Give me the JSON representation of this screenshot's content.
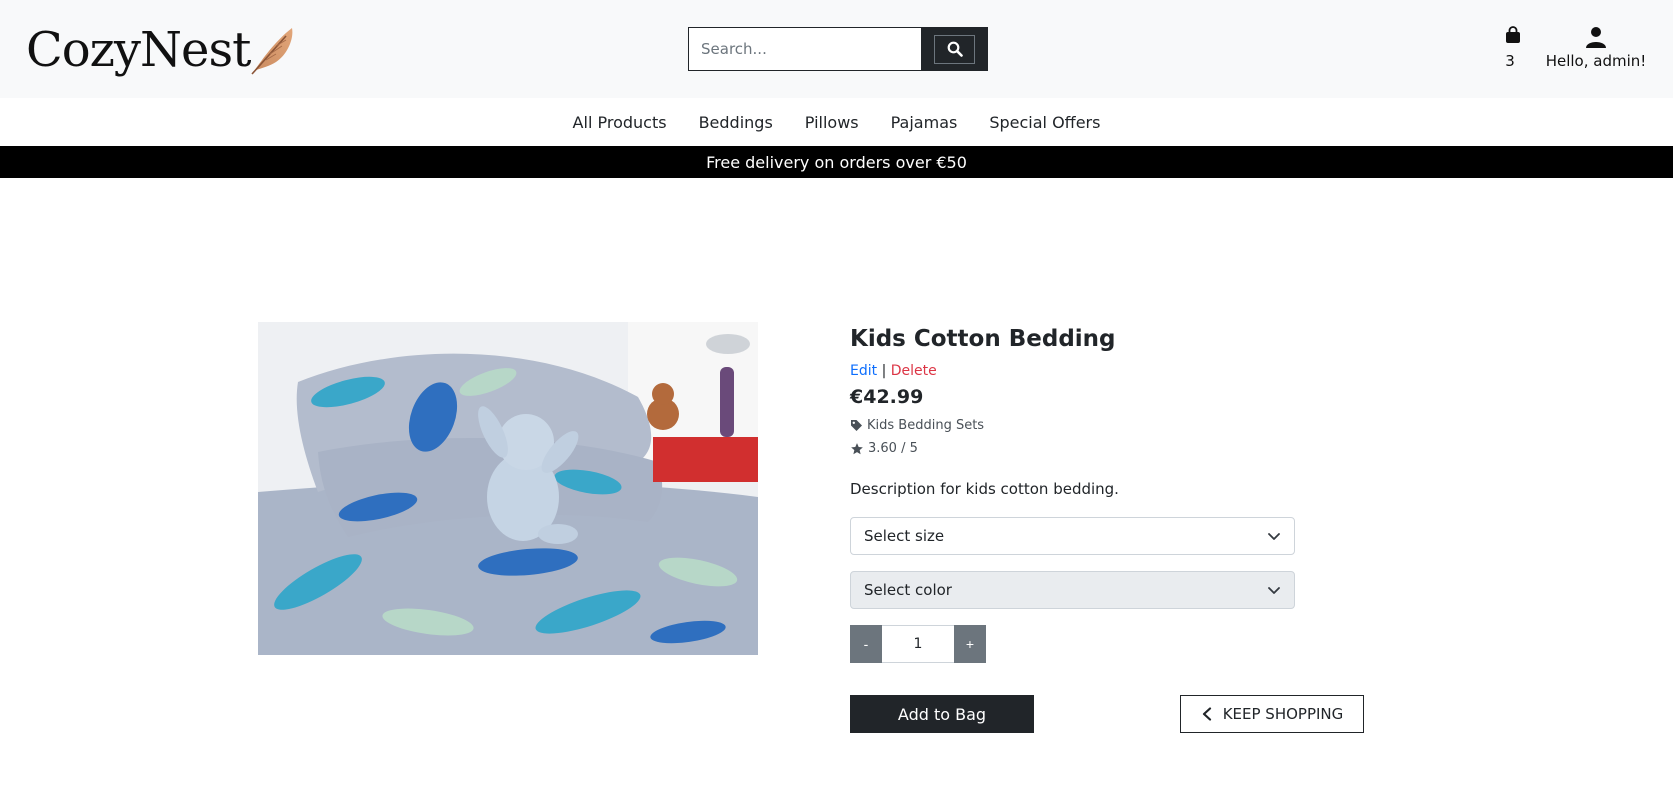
{
  "brand": {
    "name": "CozyNest",
    "logo_icon": "feather-icon"
  },
  "search": {
    "placeholder": "Search..."
  },
  "account": {
    "bag_count": "3",
    "greeting": "Hello, admin!"
  },
  "nav": {
    "items": [
      {
        "label": "All Products"
      },
      {
        "label": "Beddings"
      },
      {
        "label": "Pillows"
      },
      {
        "label": "Pajamas"
      },
      {
        "label": "Special Offers"
      }
    ]
  },
  "banner": {
    "text": "Free delivery on orders over €50"
  },
  "product": {
    "title": "Kids Cotton Bedding",
    "edit_label": "Edit",
    "separator": "|",
    "delete_label": "Delete",
    "price": "€42.99",
    "category": "Kids Bedding Sets",
    "rating": "3.60 / 5",
    "description": "Description for kids cotton bedding.",
    "size_select": "Select size",
    "color_select": "Select color",
    "qty_minus": "-",
    "qty_value": "1",
    "qty_plus": "+",
    "add_to_bag": "Add to Bag",
    "keep_shopping": "KEEP SHOPPING"
  },
  "colors": {
    "dark": "#212529",
    "banner": "#000000",
    "edit": "#0d6efd",
    "delete": "#dc3545",
    "muted": "#6c757d"
  }
}
